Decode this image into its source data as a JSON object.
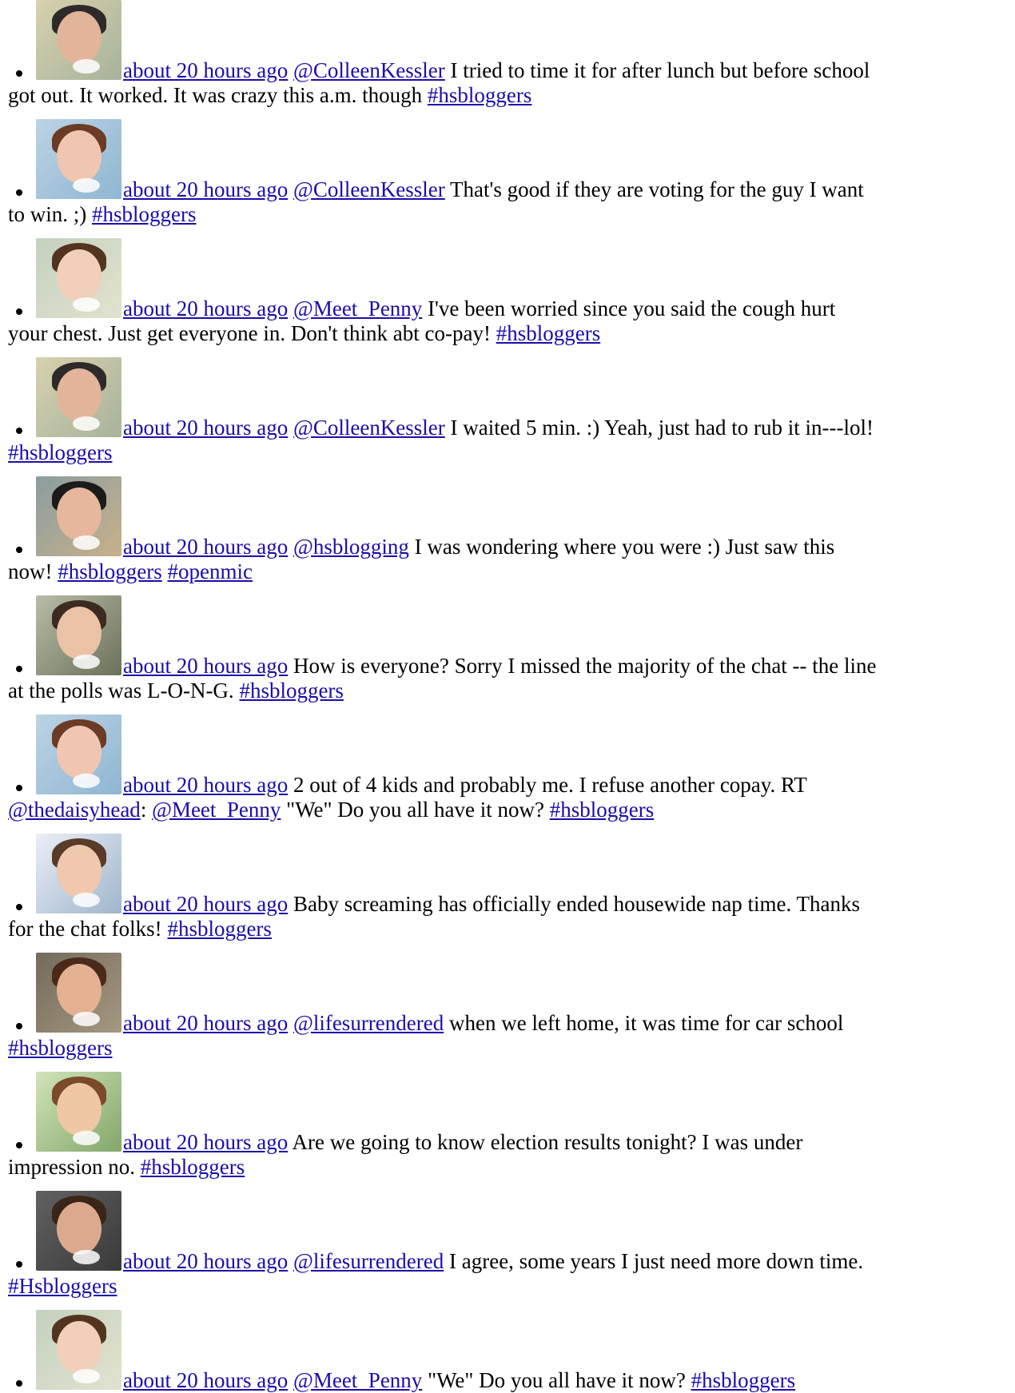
{
  "tweets": [
    {
      "avatar": 0,
      "time": "about 20 hours ago",
      "first": [
        {
          "t": "link",
          "v": "@ColleenKessler"
        },
        {
          "t": "text",
          "v": " I tried to time it for after lunch but before school"
        }
      ],
      "rest": [
        {
          "t": "text",
          "v": "got out. It worked. It was crazy this a.m. though "
        },
        {
          "t": "link",
          "v": "#hsbloggers"
        }
      ]
    },
    {
      "avatar": 1,
      "time": "about 20 hours ago",
      "first": [
        {
          "t": "link",
          "v": "@ColleenKessler"
        },
        {
          "t": "text",
          "v": " That's good if they are voting for the guy I want"
        }
      ],
      "rest": [
        {
          "t": "text",
          "v": "to win. ;) "
        },
        {
          "t": "link",
          "v": "#hsbloggers"
        }
      ]
    },
    {
      "avatar": 2,
      "time": "about 20 hours ago",
      "first": [
        {
          "t": "link",
          "v": "@Meet_Penny"
        },
        {
          "t": "text",
          "v": " I've been worried since you said the cough hurt"
        }
      ],
      "rest": [
        {
          "t": "text",
          "v": "your chest. Just get everyone in. Don't think abt co-pay! "
        },
        {
          "t": "link",
          "v": "#hsbloggers"
        }
      ]
    },
    {
      "avatar": 0,
      "time": "about 20 hours ago",
      "first": [
        {
          "t": "link",
          "v": "@ColleenKessler"
        },
        {
          "t": "text",
          "v": " I waited 5 min. :) Yeah, just had to rub it in---lol!"
        }
      ],
      "rest": [
        {
          "t": "link",
          "v": "#hsbloggers"
        }
      ]
    },
    {
      "avatar": 3,
      "time": "about 20 hours ago",
      "first": [
        {
          "t": "link",
          "v": "@hsblogging"
        },
        {
          "t": "text",
          "v": " I was wondering where you were :) Just saw this"
        }
      ],
      "rest": [
        {
          "t": "text",
          "v": "now! "
        },
        {
          "t": "link",
          "v": "#hsbloggers"
        },
        {
          "t": "text",
          "v": " "
        },
        {
          "t": "link",
          "v": "#openmic"
        }
      ]
    },
    {
      "avatar": 4,
      "time": "about 20 hours ago",
      "first": [
        {
          "t": "text",
          "v": " How is everyone? Sorry I missed the majority of the chat -- the line"
        }
      ],
      "rest": [
        {
          "t": "text",
          "v": "at the polls was L-O-N-G. "
        },
        {
          "t": "link",
          "v": "#hsbloggers"
        }
      ]
    },
    {
      "avatar": 1,
      "time": "about 20 hours ago",
      "first": [
        {
          "t": "text",
          "v": " 2 out of 4 kids and probably me. I refuse another copay. RT"
        }
      ],
      "rest": [
        {
          "t": "link",
          "v": "@thedaisyhead"
        },
        {
          "t": "text",
          "v": ": "
        },
        {
          "t": "link",
          "v": "@Meet_Penny"
        },
        {
          "t": "text",
          "v": " \"We\" Do you all have it now? "
        },
        {
          "t": "link",
          "v": "#hsbloggers"
        }
      ]
    },
    {
      "avatar": 5,
      "time": "about 20 hours ago",
      "first": [
        {
          "t": "text",
          "v": " Baby screaming has officially ended housewide nap time. Thanks"
        }
      ],
      "rest": [
        {
          "t": "text",
          "v": "for the chat folks! "
        },
        {
          "t": "link",
          "v": "#hsbloggers"
        }
      ]
    },
    {
      "avatar": 6,
      "time": "about 20 hours ago",
      "first": [
        {
          "t": "link",
          "v": "@lifesurrendered"
        },
        {
          "t": "text",
          "v": " when we left home, it was time for car school"
        }
      ],
      "rest": [
        {
          "t": "link",
          "v": "#hsbloggers"
        }
      ]
    },
    {
      "avatar": 7,
      "time": "about 20 hours ago",
      "first": [
        {
          "t": "text",
          "v": " Are we going to know election results tonight? I was under"
        }
      ],
      "rest": [
        {
          "t": "text",
          "v": "impression no. "
        },
        {
          "t": "link",
          "v": "#hsbloggers"
        }
      ]
    },
    {
      "avatar": 8,
      "time": "about 20 hours ago",
      "first": [
        {
          "t": "link",
          "v": "@lifesurrendered"
        },
        {
          "t": "text",
          "v": " I agree, some years I just need more down time."
        }
      ],
      "rest": [
        {
          "t": "link",
          "v": "#Hsbloggers"
        }
      ]
    },
    {
      "avatar": 2,
      "time": "about 20 hours ago",
      "first": [
        {
          "t": "link",
          "v": "@Meet_Penny"
        },
        {
          "t": "text",
          "v": " \"We\" Do you all have it now? "
        },
        {
          "t": "link",
          "v": "#hsbloggers"
        }
      ],
      "rest": []
    }
  ]
}
